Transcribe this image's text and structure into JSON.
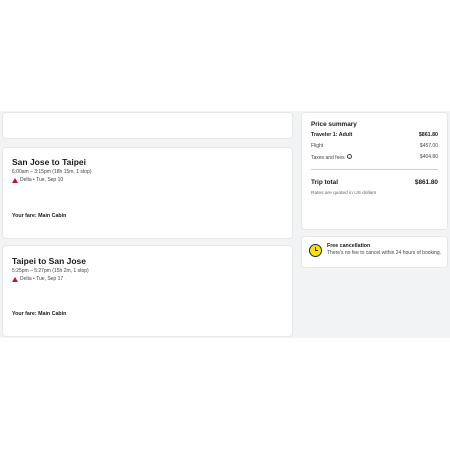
{
  "trips": [
    {
      "title": "San Jose to Taipei",
      "times": "6:00am – 3:15pm (18h 15m, 1 stop)",
      "carrier": "Delta • Tue, Sep 10",
      "fare": "Your fare: Main Cabin"
    },
    {
      "title": "Taipei to San Jose",
      "times": "5:25pm – 5:27pm (15h 2m, 1 stop)",
      "carrier": "Delta • Tue, Sep 17",
      "fare": "Your fare: Main Cabin"
    }
  ],
  "price_summary": {
    "title": "Price summary",
    "traveler_label": "Traveler 1: Adult",
    "traveler_amount": "$861.80",
    "flight_label": "Flight",
    "flight_amount": "$457.00",
    "taxes_label": "Taxes and fees",
    "taxes_amount": "$404.80",
    "total_label": "Trip total",
    "total_amount": "$861.80",
    "currency_note": "Rates are quoted in US dollars"
  },
  "cancellation": {
    "title": "Free cancellation",
    "text": "There's no fee to cancel within 24 hours of booking."
  },
  "colors": {
    "background_band": "#f2f3f5",
    "delta_red": "#c8102e",
    "clock_yellow": "#ffe000",
    "clock_navy": "#0a2a66"
  }
}
